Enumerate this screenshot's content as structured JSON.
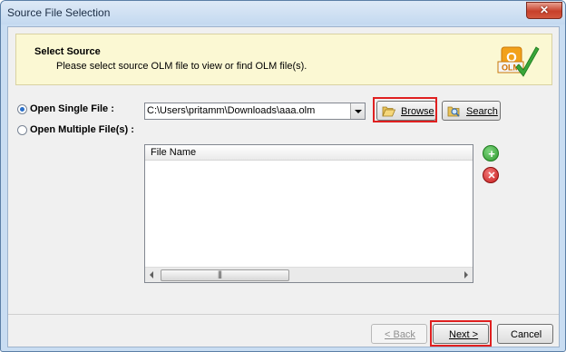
{
  "window": {
    "title": "Source File Selection"
  },
  "header": {
    "title": "Select Source",
    "subtitle": "Please select source OLM file to view or find OLM file(s).",
    "logo_text": "OLM"
  },
  "options": {
    "single_file": {
      "label": "Open Single File :",
      "checked": true
    },
    "multiple_files": {
      "label": "Open Multiple File(s) :",
      "checked": false
    }
  },
  "path_combo": {
    "value": "C:\\Users\\pritamm\\Downloads\\aaa.olm"
  },
  "buttons": {
    "browse": "Browse",
    "search": "Search",
    "back": "< Back",
    "next": "Next >",
    "cancel": "Cancel"
  },
  "file_list": {
    "columns": [
      "File Name"
    ],
    "rows": []
  },
  "icons": {
    "add": "plus-icon",
    "remove": "x-icon",
    "browse": "folder-open-icon",
    "search": "magnifier-folder-icon",
    "close": "close-icon",
    "logo": "olm-checkmark-logo"
  },
  "colors": {
    "highlight": "#e02020",
    "add": "#3aa63a",
    "remove": "#d02020"
  }
}
